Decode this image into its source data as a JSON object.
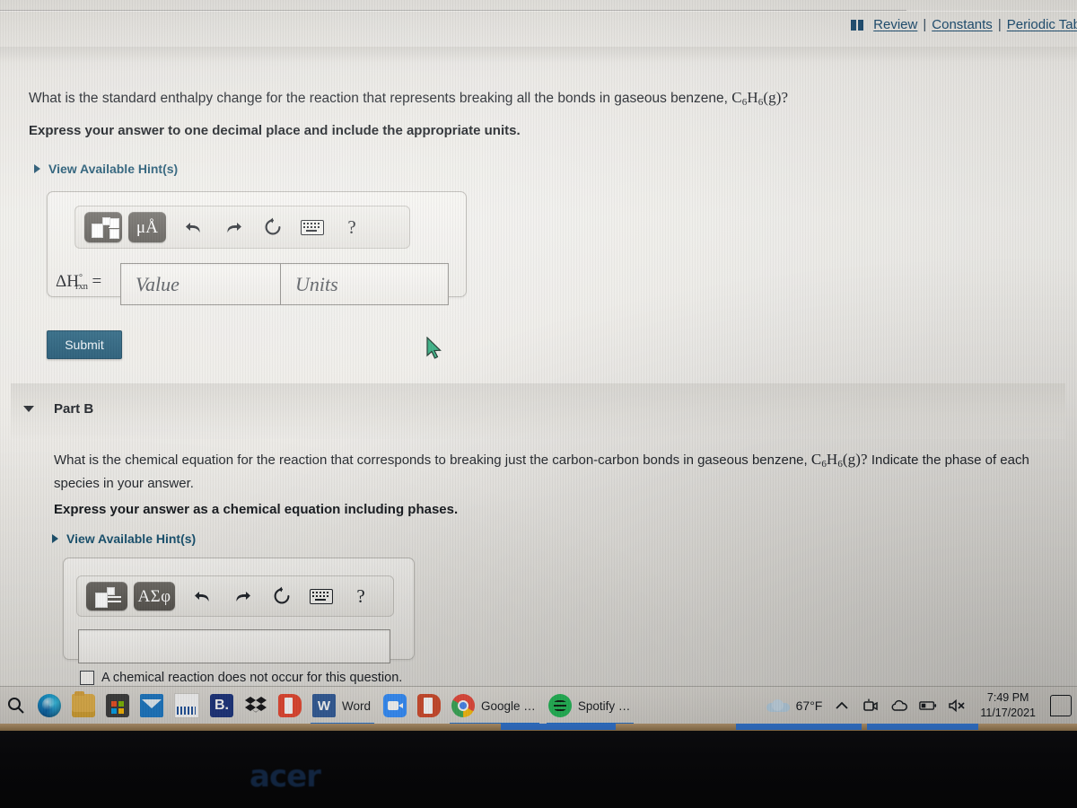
{
  "header": {
    "book_icon": "book-icon",
    "review_label": "Review",
    "separator": "|",
    "constants_label": "Constants",
    "periodic_label": "Periodic Tab"
  },
  "part_a": {
    "question_prefix": "What is the standard enthalpy change for the reaction that represents breaking all the bonds in gaseous benzene, ",
    "question_formula_c": "C",
    "question_formula_c_sub": "6",
    "question_formula_h": "H",
    "question_formula_h_sub": "6",
    "question_formula_state": "(g)?",
    "instruction": "Express your answer to one decimal place and include the appropriate units.",
    "hint_label": "View Available Hint(s)",
    "toolbar": {
      "template_icon": "template-superscript-fraction-icon",
      "units_label": "μÅ",
      "undo_icon": "undo-arrow-icon",
      "redo_icon": "redo-arrow-icon",
      "reset_icon": "reset-circular-arrow-icon",
      "keyboard_icon": "keyboard-icon",
      "help_label": "?"
    },
    "answer_label_delta": "ΔH",
    "answer_label_sup": "°",
    "answer_label_sub": "rxn",
    "answer_label_eq": "=",
    "value_placeholder": "Value",
    "units_placeholder": "Units",
    "value_current": "",
    "units_current": "",
    "submit_label": "Submit"
  },
  "part_b": {
    "section_title": "Part B",
    "collapse_icon": "triangle-down-icon",
    "question_prefix": "What is the chemical equation for the reaction that corresponds to breaking just the carbon-carbon bonds in gaseous benzene, ",
    "question_formula_c": "C",
    "question_formula_c_sub": "6",
    "question_formula_h": "H",
    "question_formula_h_sub": "6",
    "question_formula_state": "(g)?",
    "question_suffix": " Indicate the phase of each species in your answer.",
    "instruction": "Express your answer as a chemical equation including phases.",
    "hint_label": "View Available Hint(s)",
    "toolbar": {
      "template_icon": "template-reaction-arrow-icon",
      "greek_label": "ΑΣφ",
      "undo_icon": "undo-arrow-icon",
      "redo_icon": "redo-arrow-icon",
      "reset_icon": "reset-circular-arrow-icon",
      "keyboard_icon": "keyboard-icon",
      "help_label": "?"
    },
    "answer_current": "",
    "no_reaction_label": "A chemical reaction does not occur for this question."
  },
  "taskbar": {
    "items": [
      {
        "name": "search",
        "icon": "search-icon",
        "label": ""
      },
      {
        "name": "edge",
        "icon": "edge-browser-icon",
        "label": ""
      },
      {
        "name": "file-explorer",
        "icon": "folder-icon",
        "label": ""
      },
      {
        "name": "microsoft-store",
        "icon": "store-icon",
        "label": ""
      },
      {
        "name": "mail",
        "icon": "mail-icon",
        "label": ""
      },
      {
        "name": "amazon",
        "icon": "amazon-icon",
        "label": ""
      },
      {
        "name": "booking",
        "icon": "booking-icon",
        "label": "B."
      },
      {
        "name": "dropbox",
        "icon": "dropbox-icon",
        "label": ""
      },
      {
        "name": "office",
        "icon": "office-icon",
        "label": ""
      },
      {
        "name": "word",
        "icon": "word-icon",
        "label": "Word"
      },
      {
        "name": "zoom",
        "icon": "zoom-icon",
        "label": ""
      },
      {
        "name": "powerpoint",
        "icon": "powerpoint-icon",
        "label": ""
      },
      {
        "name": "chrome",
        "icon": "chrome-icon",
        "label": "Google …"
      },
      {
        "name": "spotify",
        "icon": "spotify-icon",
        "label": "Spotify …"
      }
    ],
    "tray": {
      "weather_icon": "cloud-icon",
      "temperature": "67°F",
      "chevron_icon": "chevron-up-icon",
      "camera_icon": "camera-icon",
      "onedrive_icon": "onedrive-cloud-icon",
      "battery_icon": "battery-icon",
      "volume_icon": "volume-muted-icon",
      "time": "7:49 PM",
      "date": "11/17/2021",
      "notifications_icon": "notification-icon"
    }
  },
  "device": {
    "brand_logo": "acer"
  },
  "cursor": {
    "icon": "mouse-pointer-icon",
    "color": "#2aa87a"
  }
}
